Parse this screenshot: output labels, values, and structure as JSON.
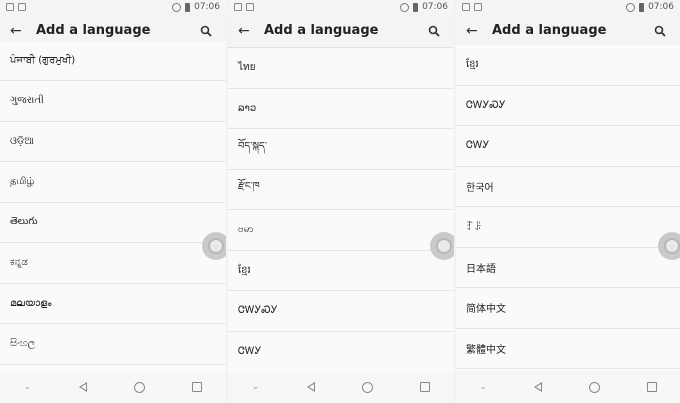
{
  "status": {
    "time": "07:06"
  },
  "appbar": {
    "title": "Add a language"
  },
  "panels": [
    {
      "items": [
        "ਪੰਜਾਬੀ (ਗੁਰਮੁਖੀ)",
        "ગુજરાતી",
        "ଓଡ଼ିଆ",
        "தமிழ்",
        "తెలుగు",
        "ಕನ್ನಡ",
        "മലയാളം",
        "සිංහල"
      ]
    },
    {
      "items": [
        "ไทย",
        "ລາວ",
        "བོད་སྐད་",
        "རྫོང་ཁ",
        "ဗမာ",
        "ខ្មែរ",
        "ᏣᎳᎩᏍᎩ",
        "ᏣᎳᎩ"
      ]
    },
    {
      "items": [
        "ខ្មែរ",
        "ᏣᎳᎩᏍᎩ",
        "ᏣᎳᎩ",
        "한국어",
        "ꆈꌠ",
        "日本語",
        "简体中文",
        "繁體中文"
      ]
    }
  ],
  "icons": {
    "back": "arrow-back-icon",
    "search": "search-icon",
    "nav_back": "nav-back-icon",
    "nav_home": "nav-home-icon",
    "nav_recents": "nav-recents-icon"
  }
}
